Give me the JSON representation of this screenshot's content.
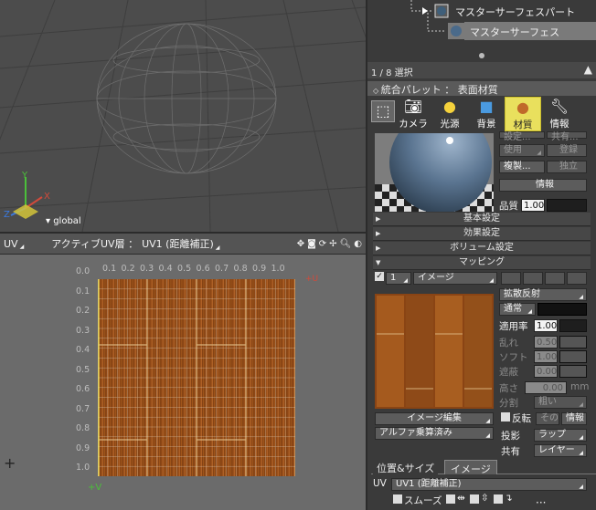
{
  "viewport": {
    "coordinate_mode": "global",
    "axis_x": "X",
    "axis_y": "Y",
    "axis_z": "Z"
  },
  "uv_header": {
    "uv_menu": "UV",
    "active_layer_label": "アクティブUV層 ：",
    "active_layer_value": "UV1 (距離補正)"
  },
  "uv_editor": {
    "u_ticks": [
      "0.1",
      "0.2",
      "0.3",
      "0.4",
      "0.5",
      "0.6",
      "0.7",
      "0.8",
      "0.9",
      "1.0"
    ],
    "v_ticks": [
      "0.0",
      "0.1",
      "0.2",
      "0.3",
      "0.4",
      "0.5",
      "0.6",
      "0.7",
      "0.8",
      "0.9",
      "1.0"
    ],
    "plus_v": "+V",
    "red_label": "+U"
  },
  "scene_tree": {
    "items": [
      {
        "label": "マスターサーフェスパート"
      },
      {
        "label": "マスターサーフェス"
      }
    ]
  },
  "selection": {
    "status": "1 / 8 選択"
  },
  "palette": {
    "title": "統合パレット ： 表面材質",
    "tabs": [
      {
        "label": "",
        "icon": "cursor-icon"
      },
      {
        "label": "カメラ",
        "icon": "camera-icon"
      },
      {
        "label": "光源",
        "icon": "light-icon"
      },
      {
        "label": "背景",
        "icon": "background-icon"
      },
      {
        "label": "材質",
        "icon": "material-icon",
        "active": true
      },
      {
        "label": "情報",
        "icon": "wrench-icon"
      }
    ]
  },
  "material": {
    "top_buttons": [
      "設定...",
      "共有..."
    ],
    "use_label": "使用",
    "register_label": "登録",
    "duplicate_label": "複製...",
    "independent_label": "独立",
    "info_label": "情報",
    "quality_label": "品質",
    "quality_value": "1.00"
  },
  "sections": {
    "basic": "基本設定",
    "effect": "効果設定",
    "volume": "ボリューム設定",
    "mapping": "マッピング"
  },
  "mapping": {
    "layer_number": "1",
    "type": "イメージ",
    "channel": "拡散反射",
    "blend_mode": "通常",
    "rate_label": "適用率",
    "rate_value": "1.00",
    "disorder_label": "乱れ",
    "disorder_value": "0.50",
    "soft_label": "ソフト",
    "soft_value": "1.00",
    "shield_label": "遮蔽",
    "shield_value": "0.00",
    "height_label": "高さ",
    "height_value": "0.00",
    "height_unit": "mm",
    "divide_label": "分割",
    "divide_value": "粗い",
    "flip_label": "反転",
    "flip_other": "その",
    "info_button": "情報",
    "edit_image": "イメージ編集",
    "alpha_mode": "アルファ乗算済み",
    "projection_label": "投影",
    "projection_value": "ラップ",
    "share_label": "共有",
    "share_value": "レイヤー"
  },
  "bottom_tabs": {
    "position_size": "位置&サイズ",
    "image": "イメージ"
  },
  "uv_row": {
    "label": "UV",
    "value": "UV1 (距離補正)",
    "smooth_label": "スムーズ"
  }
}
